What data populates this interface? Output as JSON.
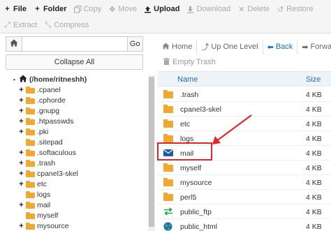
{
  "toolbar": {
    "row1": [
      {
        "label": "File",
        "enabled": true,
        "icon": "plus-icon"
      },
      {
        "label": "Folder",
        "enabled": true,
        "icon": "plus-icon"
      },
      {
        "label": "Copy",
        "enabled": false,
        "icon": "copy-icon"
      },
      {
        "label": "Move",
        "enabled": false,
        "icon": "move-icon"
      },
      {
        "label": "Upload",
        "enabled": true,
        "icon": "upload-icon"
      },
      {
        "label": "Download",
        "enabled": false,
        "icon": "download-icon"
      },
      {
        "label": "Delete",
        "enabled": false,
        "icon": "close-icon"
      },
      {
        "label": "Restore",
        "enabled": false,
        "icon": "restore-icon"
      }
    ],
    "row2": [
      {
        "label": "Extract",
        "enabled": false,
        "icon": "extract-icon"
      },
      {
        "label": "Compress",
        "enabled": false,
        "icon": "compress-icon"
      }
    ]
  },
  "left": {
    "path_value": "",
    "go_label": "Go",
    "collapse_label": "Collapse All",
    "tree": [
      {
        "label": "(/home/ritneshh)",
        "toggle": "-",
        "root": true,
        "indent": 0
      },
      {
        "label": ".cpanel",
        "toggle": "+",
        "indent": 1
      },
      {
        "label": ".cphorde",
        "toggle": "+",
        "indent": 1
      },
      {
        "label": ".gnupg",
        "toggle": "+",
        "indent": 1
      },
      {
        "label": ".htpasswds",
        "toggle": "+",
        "indent": 1
      },
      {
        "label": ".pki",
        "toggle": "+",
        "indent": 1
      },
      {
        "label": ".sitepad",
        "toggle": "",
        "indent": 1
      },
      {
        "label": ".softaculous",
        "toggle": "+",
        "indent": 1
      },
      {
        "label": ".trash",
        "toggle": "+",
        "indent": 1
      },
      {
        "label": "cpanel3-skel",
        "toggle": "+",
        "indent": 1
      },
      {
        "label": "etc",
        "toggle": "+",
        "indent": 1
      },
      {
        "label": "logs",
        "toggle": "",
        "indent": 1
      },
      {
        "label": "mail",
        "toggle": "+",
        "indent": 1
      },
      {
        "label": "myself",
        "toggle": "",
        "indent": 1
      },
      {
        "label": "mysource",
        "toggle": "+",
        "indent": 1
      }
    ]
  },
  "right": {
    "nav": [
      {
        "label": "Home",
        "icon": "home-icon",
        "active": false
      },
      {
        "label": "Up One Level",
        "icon": "level-up-icon",
        "active": false
      },
      {
        "label": "Back",
        "icon": "arrow-left-icon",
        "active": true
      },
      {
        "label": "Forward",
        "icon": "arrow-right-icon",
        "active": false
      }
    ],
    "empty_trash_label": "Empty Trash",
    "columns": {
      "name": "Name",
      "size": "Size"
    },
    "rows": [
      {
        "name": ".trash",
        "size": "4 KB",
        "icon": "folder-icon"
      },
      {
        "name": "cpanel3-skel",
        "size": "4 KB",
        "icon": "folder-icon"
      },
      {
        "name": "etc",
        "size": "4 KB",
        "icon": "folder-icon"
      },
      {
        "name": "logs",
        "size": "4 KB",
        "icon": "folder-icon"
      },
      {
        "name": "mail",
        "size": "4 KB",
        "icon": "mail-icon"
      },
      {
        "name": "myself",
        "size": "4 KB",
        "icon": "folder-icon"
      },
      {
        "name": "mysource",
        "size": "4 KB",
        "icon": "folder-icon"
      },
      {
        "name": "perl5",
        "size": "4 KB",
        "icon": "folder-icon"
      },
      {
        "name": "public_ftp",
        "size": "4 KB",
        "icon": "transfer-icon"
      },
      {
        "name": "public_html",
        "size": "4 KB",
        "icon": "globe-icon"
      }
    ]
  },
  "colors": {
    "folder": "#f0a830",
    "link": "#1a6fb8",
    "highlight": "#e3252b",
    "mail_icon": "#1d5ca8",
    "transfer_icon": "#2aa44f",
    "globe_icon": "#1a6fb8"
  }
}
